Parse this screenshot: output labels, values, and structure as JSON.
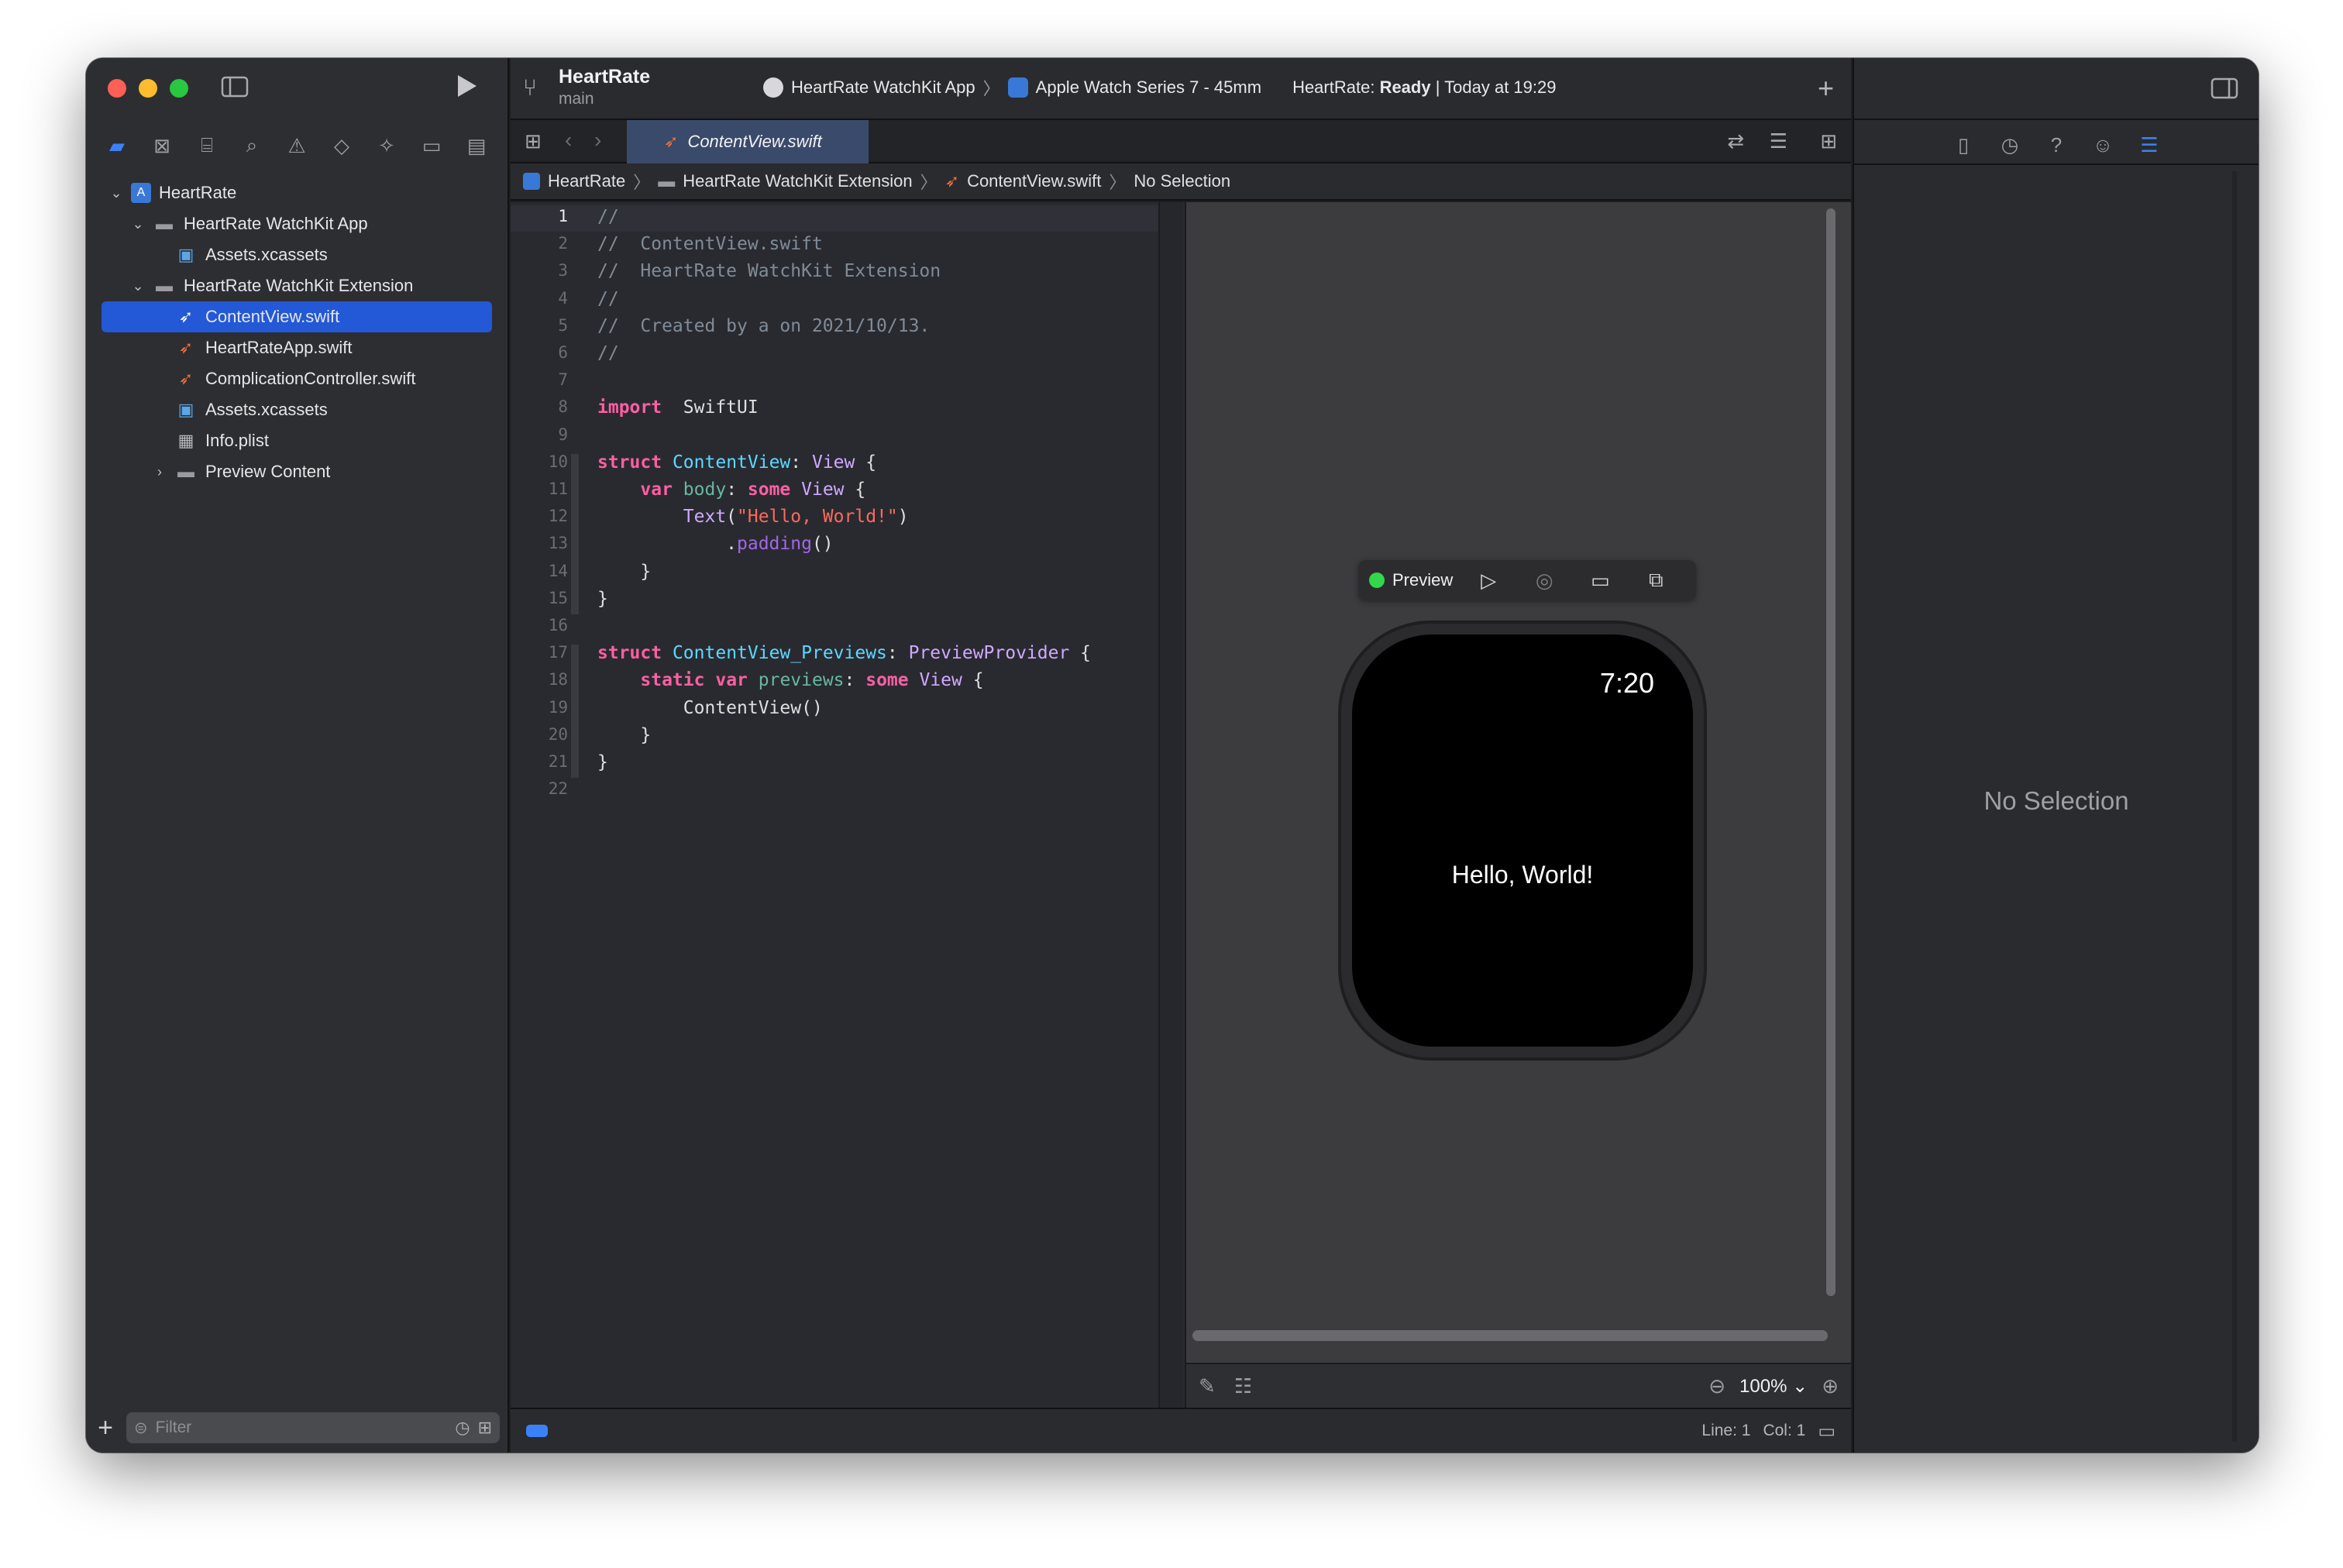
{
  "toolbar": {
    "project_title": "HeartRate",
    "branch": "main",
    "scheme_target": "HeartRate WatchKit App",
    "scheme_device": "Apple Watch Series 7 - 45mm",
    "status_prefix": "HeartRate: ",
    "status_state": "Ready",
    "status_suffix": " | Today at 19:29"
  },
  "navigator": {
    "items": [
      {
        "label": "HeartRate"
      },
      {
        "label": "HeartRate WatchKit App"
      },
      {
        "label": "Assets.xcassets"
      },
      {
        "label": "HeartRate WatchKit Extension"
      },
      {
        "label": "ContentView.swift"
      },
      {
        "label": "HeartRateApp.swift"
      },
      {
        "label": "ComplicationController.swift"
      },
      {
        "label": "Assets.xcassets"
      },
      {
        "label": "Info.plist"
      },
      {
        "label": "Preview Content"
      }
    ],
    "filter_placeholder": "Filter"
  },
  "editor": {
    "tab_label": "ContentView.swift",
    "jumpbar": [
      "HeartRate",
      "HeartRate WatchKit Extension",
      "ContentView.swift",
      "No Selection"
    ],
    "line_numbers": [
      "1",
      "2",
      "3",
      "4",
      "5",
      "6",
      "7",
      "8",
      "9",
      "10",
      "11",
      "12",
      "13",
      "14",
      "15",
      "16",
      "17",
      "18",
      "19",
      "20",
      "21",
      "22"
    ]
  },
  "preview": {
    "label": "Preview",
    "watch_time": "7:20",
    "watch_text": "Hello, World!",
    "zoom": "100%"
  },
  "statusbar": {
    "line": "Line: 1",
    "col": "Col: 1"
  },
  "inspector": {
    "empty_text": "No Selection"
  }
}
